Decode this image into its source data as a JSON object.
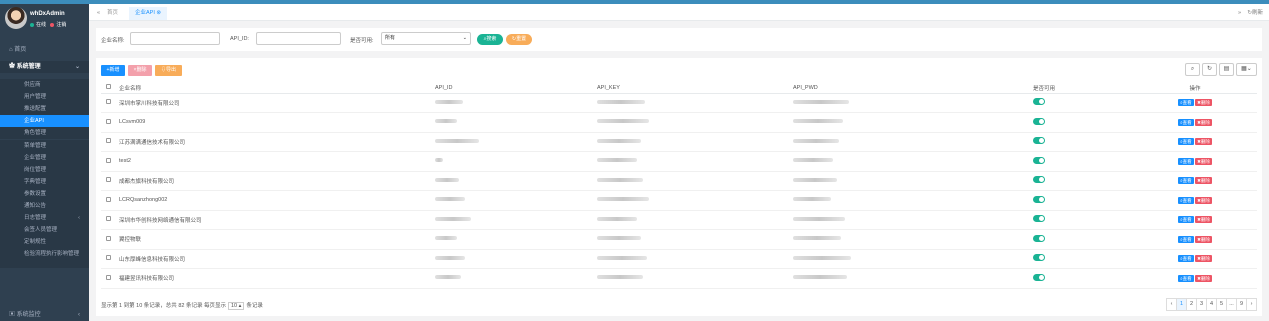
{
  "user": {
    "name": "whDxAdmin",
    "online": "在线",
    "logout": "注销"
  },
  "nav": {
    "home": "首页",
    "group": "系统管理",
    "items": [
      "供应商",
      "用户管理",
      "推送配置",
      "企业API",
      "角色管理",
      "菜单管理",
      "企业管理",
      "岗位管理",
      "字典管理",
      "参数设置",
      "通知公告",
      "日志管理",
      "会签人员管理",
      "定制规性",
      "检验流程执行影响管理"
    ],
    "bottom": "系统监控"
  },
  "tabs": {
    "home": "首页",
    "active": "企业API",
    "refresh": "刷新"
  },
  "search": {
    "company_label": "企业名称:",
    "company_value": "",
    "api_id_label": "API_ID:",
    "api_id_value": "",
    "available_label": "是否可用:",
    "available_value": "所有",
    "search_btn": "搜索",
    "reset_btn": "重置"
  },
  "toolbar": {
    "add": "新增",
    "delete": "删除",
    "export": "导出"
  },
  "table": {
    "headers": [
      "企业名称",
      "API_ID",
      "API_KEY",
      "API_PWD",
      "是否可用",
      "操作"
    ],
    "rows": [
      {
        "name": "深圳市掌川科技有限公司"
      },
      {
        "name": "LCsvm009"
      },
      {
        "name": "江苏满满通信技术有限公司"
      },
      {
        "name": "test2"
      },
      {
        "name": "成都杰旗科技有限公司"
      },
      {
        "name": "LCRQsanzhong002"
      },
      {
        "name": "深圳市华创科技网络通信有限公司"
      },
      {
        "name": "翼控物联"
      },
      {
        "name": "山东厚峰信息科技有限公司"
      },
      {
        "name": "福建昱讯科技有限公司"
      }
    ],
    "view_label": "查看",
    "delete_label": "删除"
  },
  "footer": {
    "text1": "显示第 1 到第 10 条记录，总共 82 条记录 每页显示",
    "page_size": "10",
    "text2": "条记录"
  },
  "pagination": [
    "‹",
    "1",
    "2",
    "3",
    "4",
    "5",
    "...",
    "9",
    "›"
  ],
  "colors": {
    "sidebar": "#2f4050",
    "accent": "#1890ff",
    "search_btn": "#1ab394",
    "reset_btn": "#f8ac59",
    "add": "#1890ff",
    "delete": "#ed5565",
    "export": "#f8ac59",
    "view": "#1890ff",
    "toggle": "#1ab394"
  }
}
